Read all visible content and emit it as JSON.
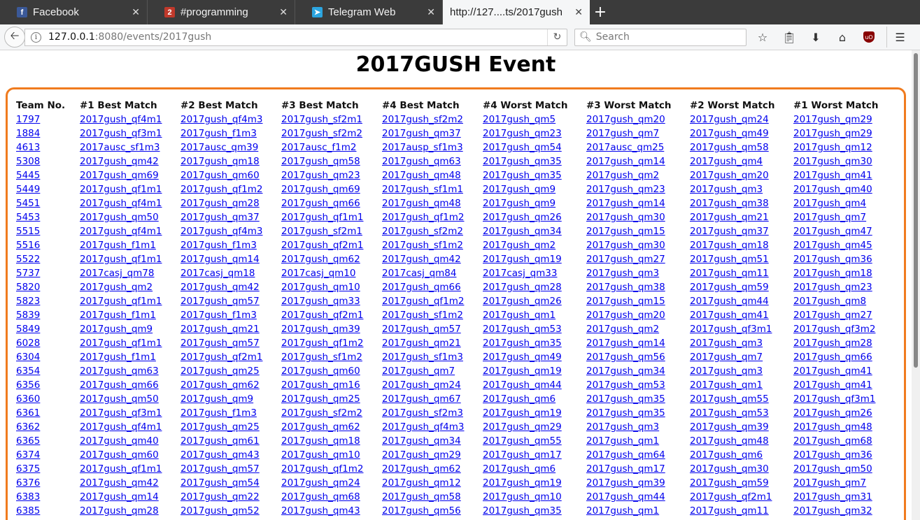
{
  "tabs": [
    {
      "title": "Facebook",
      "icon": "facebook-icon",
      "color": "#3b5998",
      "glyph": "f"
    },
    {
      "title": "#programming",
      "icon": "irc-icon",
      "color": "#c0392b",
      "glyph": "2"
    },
    {
      "title": "Telegram Web",
      "icon": "telegram-icon",
      "color": "#2ca5e0",
      "glyph": "➤"
    },
    {
      "title": "http://127....ts/2017gush",
      "icon": "",
      "color": "",
      "glyph": ""
    }
  ],
  "navbar": {
    "url_host": "127.0.0.1",
    "url_path": ":8080/events/2017gush",
    "search_placeholder": "Search"
  },
  "page": {
    "title": "2017GUSH Event",
    "accent_color": "#f07b1e",
    "headers": [
      "Team No.",
      "#1 Best Match",
      "#2 Best Match",
      "#3 Best Match",
      "#4 Best Match",
      "#4 Worst Match",
      "#3 Worst Match",
      "#2 Worst Match",
      "#1 Worst Match"
    ],
    "rows": [
      [
        "1797",
        "2017gush_qf4m1",
        "2017gush_qf4m3",
        "2017gush_sf2m1",
        "2017gush_sf2m2",
        "2017gush_qm5",
        "2017gush_qm20",
        "2017gush_qm24",
        "2017gush_qm29"
      ],
      [
        "1884",
        "2017gush_qf3m1",
        "2017gush_f1m3",
        "2017gush_sf2m2",
        "2017gush_qm37",
        "2017gush_qm23",
        "2017gush_qm7",
        "2017gush_qm49",
        "2017gush_qm29"
      ],
      [
        "4613",
        "2017ausc_sf1m3",
        "2017ausc_qm39",
        "2017ausc_f1m2",
        "2017ausp_sf1m3",
        "2017gush_qm54",
        "2017ausc_qm25",
        "2017gush_qm58",
        "2017gush_qm12"
      ],
      [
        "5308",
        "2017gush_qm42",
        "2017gush_qm18",
        "2017gush_qm58",
        "2017gush_qm63",
        "2017gush_qm35",
        "2017gush_qm14",
        "2017gush_qm4",
        "2017gush_qm30"
      ],
      [
        "5445",
        "2017gush_qm69",
        "2017gush_qm60",
        "2017gush_qm23",
        "2017gush_qm48",
        "2017gush_qm35",
        "2017gush_qm2",
        "2017gush_qm20",
        "2017gush_qm41"
      ],
      [
        "5449",
        "2017gush_qf1m1",
        "2017gush_qf1m2",
        "2017gush_qm69",
        "2017gush_sf1m1",
        "2017gush_qm9",
        "2017gush_qm23",
        "2017gush_qm3",
        "2017gush_qm40"
      ],
      [
        "5451",
        "2017gush_qf4m1",
        "2017gush_qm28",
        "2017gush_qm66",
        "2017gush_qm48",
        "2017gush_qm9",
        "2017gush_qm14",
        "2017gush_qm38",
        "2017gush_qm4"
      ],
      [
        "5453",
        "2017gush_qm50",
        "2017gush_qm37",
        "2017gush_qf1m1",
        "2017gush_qf1m2",
        "2017gush_qm26",
        "2017gush_qm30",
        "2017gush_qm21",
        "2017gush_qm7"
      ],
      [
        "5515",
        "2017gush_qf4m1",
        "2017gush_qf4m3",
        "2017gush_sf2m1",
        "2017gush_sf2m2",
        "2017gush_qm34",
        "2017gush_qm15",
        "2017gush_qm37",
        "2017gush_qm47"
      ],
      [
        "5516",
        "2017gush_f1m1",
        "2017gush_f1m3",
        "2017gush_qf2m1",
        "2017gush_sf1m2",
        "2017gush_qm2",
        "2017gush_qm30",
        "2017gush_qm18",
        "2017gush_qm45"
      ],
      [
        "5522",
        "2017gush_qf1m1",
        "2017gush_qm14",
        "2017gush_qm62",
        "2017gush_qm42",
        "2017gush_qm19",
        "2017gush_qm27",
        "2017gush_qm51",
        "2017gush_qm36"
      ],
      [
        "5737",
        "2017casj_qm78",
        "2017casj_qm18",
        "2017casj_qm10",
        "2017casj_qm84",
        "2017casj_qm33",
        "2017gush_qm3",
        "2017gush_qm11",
        "2017gush_qm18"
      ],
      [
        "5820",
        "2017gush_qm2",
        "2017gush_qm42",
        "2017gush_qm10",
        "2017gush_qm66",
        "2017gush_qm28",
        "2017gush_qm38",
        "2017gush_qm59",
        "2017gush_qm23"
      ],
      [
        "5823",
        "2017gush_qf1m1",
        "2017gush_qm57",
        "2017gush_qm33",
        "2017gush_qf1m2",
        "2017gush_qm26",
        "2017gush_qm15",
        "2017gush_qm44",
        "2017gush_qm8"
      ],
      [
        "5839",
        "2017gush_f1m1",
        "2017gush_f1m3",
        "2017gush_qf2m1",
        "2017gush_sf1m2",
        "2017gush_qm1",
        "2017gush_qm20",
        "2017gush_qm41",
        "2017gush_qm27"
      ],
      [
        "5849",
        "2017gush_qm9",
        "2017gush_qm21",
        "2017gush_qm39",
        "2017gush_qm57",
        "2017gush_qm53",
        "2017gush_qm2",
        "2017gush_qf3m1",
        "2017gush_qf3m2"
      ],
      [
        "6028",
        "2017gush_qf1m1",
        "2017gush_qm57",
        "2017gush_qf1m2",
        "2017gush_qm21",
        "2017gush_qm35",
        "2017gush_qm14",
        "2017gush_qm3",
        "2017gush_qm28"
      ],
      [
        "6304",
        "2017gush_f1m1",
        "2017gush_qf2m1",
        "2017gush_sf1m2",
        "2017gush_sf1m3",
        "2017gush_qm49",
        "2017gush_qm56",
        "2017gush_qm7",
        "2017gush_qm66"
      ],
      [
        "6354",
        "2017gush_qm63",
        "2017gush_qm25",
        "2017gush_qm60",
        "2017gush_qm7",
        "2017gush_qm19",
        "2017gush_qm34",
        "2017gush_qm3",
        "2017gush_qm41"
      ],
      [
        "6356",
        "2017gush_qm66",
        "2017gush_qm62",
        "2017gush_qm16",
        "2017gush_qm24",
        "2017gush_qm44",
        "2017gush_qm53",
        "2017gush_qm1",
        "2017gush_qm41"
      ],
      [
        "6360",
        "2017gush_qm50",
        "2017gush_qm9",
        "2017gush_qm25",
        "2017gush_qm67",
        "2017gush_qm6",
        "2017gush_qm35",
        "2017gush_qm55",
        "2017gush_qf3m1"
      ],
      [
        "6361",
        "2017gush_qf3m1",
        "2017gush_f1m3",
        "2017gush_sf2m2",
        "2017gush_sf2m3",
        "2017gush_qm19",
        "2017gush_qm35",
        "2017gush_qm53",
        "2017gush_qm26"
      ],
      [
        "6362",
        "2017gush_qf4m1",
        "2017gush_qm25",
        "2017gush_qm62",
        "2017gush_qf4m3",
        "2017gush_qm29",
        "2017gush_qm3",
        "2017gush_qm39",
        "2017gush_qm48"
      ],
      [
        "6365",
        "2017gush_qm40",
        "2017gush_qm61",
        "2017gush_qm18",
        "2017gush_qm34",
        "2017gush_qm55",
        "2017gush_qm1",
        "2017gush_qm48",
        "2017gush_qm68"
      ],
      [
        "6374",
        "2017gush_qm60",
        "2017gush_qm43",
        "2017gush_qm10",
        "2017gush_qm29",
        "2017gush_qm17",
        "2017gush_qm64",
        "2017gush_qm6",
        "2017gush_qm36"
      ],
      [
        "6375",
        "2017gush_qf1m1",
        "2017gush_qm57",
        "2017gush_qf1m2",
        "2017gush_qm62",
        "2017gush_qm6",
        "2017gush_qm17",
        "2017gush_qm30",
        "2017gush_qm50"
      ],
      [
        "6376",
        "2017gush_qm42",
        "2017gush_qm54",
        "2017gush_qm24",
        "2017gush_qm12",
        "2017gush_qm19",
        "2017gush_qm39",
        "2017gush_qm59",
        "2017gush_qm7"
      ],
      [
        "6383",
        "2017gush_qm14",
        "2017gush_qm22",
        "2017gush_qm68",
        "2017gush_qm58",
        "2017gush_qm10",
        "2017gush_qm44",
        "2017gush_qf2m1",
        "2017gush_qm31"
      ],
      [
        "6385",
        "2017gush_qm28",
        "2017gush_qm52",
        "2017gush_qm43",
        "2017gush_qm56",
        "2017gush_qm35",
        "2017gush_qm1",
        "2017gush_qm11",
        "2017gush_qm32"
      ]
    ]
  }
}
